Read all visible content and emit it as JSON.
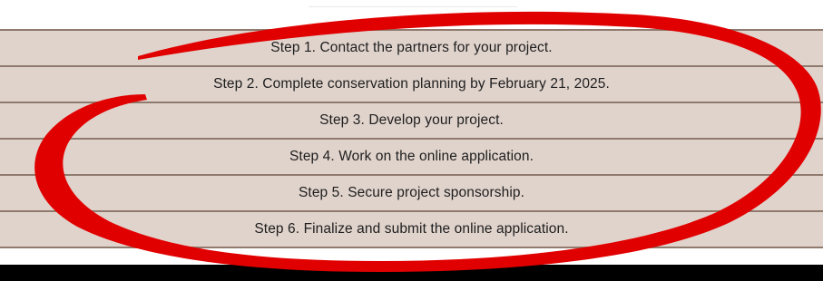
{
  "steps": [
    "Step 1. Contact the partners for your project.",
    "Step 2. Complete conservation planning by February 21, 2025.",
    "Step 3. Develop your project.",
    "Step 4. Work on the online application.",
    "Step 5. Secure project sponsorship.",
    "Step 6. Finalize and submit the online application."
  ],
  "colors": {
    "row_background": "#e0d3cc",
    "row_divider": "#8f7a6d",
    "annotation_stroke": "#e10000",
    "bottom_bar": "#000000"
  }
}
